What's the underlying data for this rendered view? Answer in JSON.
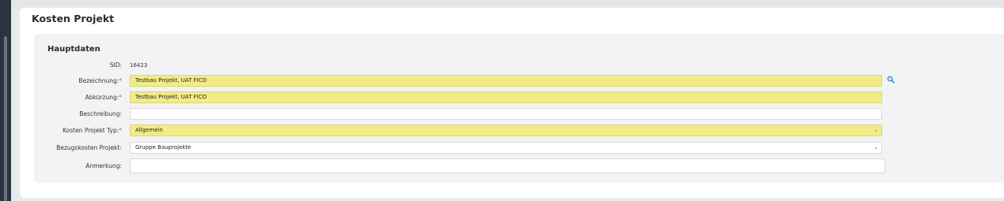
{
  "window": {
    "title": "Kosten Projekt"
  },
  "section": {
    "title": "Hauptdaten"
  },
  "fields": {
    "sid": {
      "label": "SID:",
      "value": "16423"
    },
    "bezeichnung": {
      "label": "Bezeichnung:",
      "required": "*",
      "value": "Testbau Projekt, UAT FICO"
    },
    "abkuerzung": {
      "label": "Abkürzung:",
      "required": "*",
      "value": "Testbau Projekt, UAT FICO"
    },
    "beschreibung": {
      "label": "Beschreibung:",
      "value": ""
    },
    "typ": {
      "label": "Kosten Projekt Typ:",
      "required": "*",
      "value": "Allgemein"
    },
    "bezugskosten": {
      "label": "Bezugskosten Projekt:",
      "value": "Gruppe Bauprojekte"
    },
    "anmerkung": {
      "label": "Anmerkung:",
      "value": ""
    }
  },
  "icons": {
    "search": "search-icon",
    "dropdown": "chevron-down-icon"
  },
  "colors": {
    "required_field_bg": "#f2ec87",
    "required_marker": "#e05a2a"
  }
}
